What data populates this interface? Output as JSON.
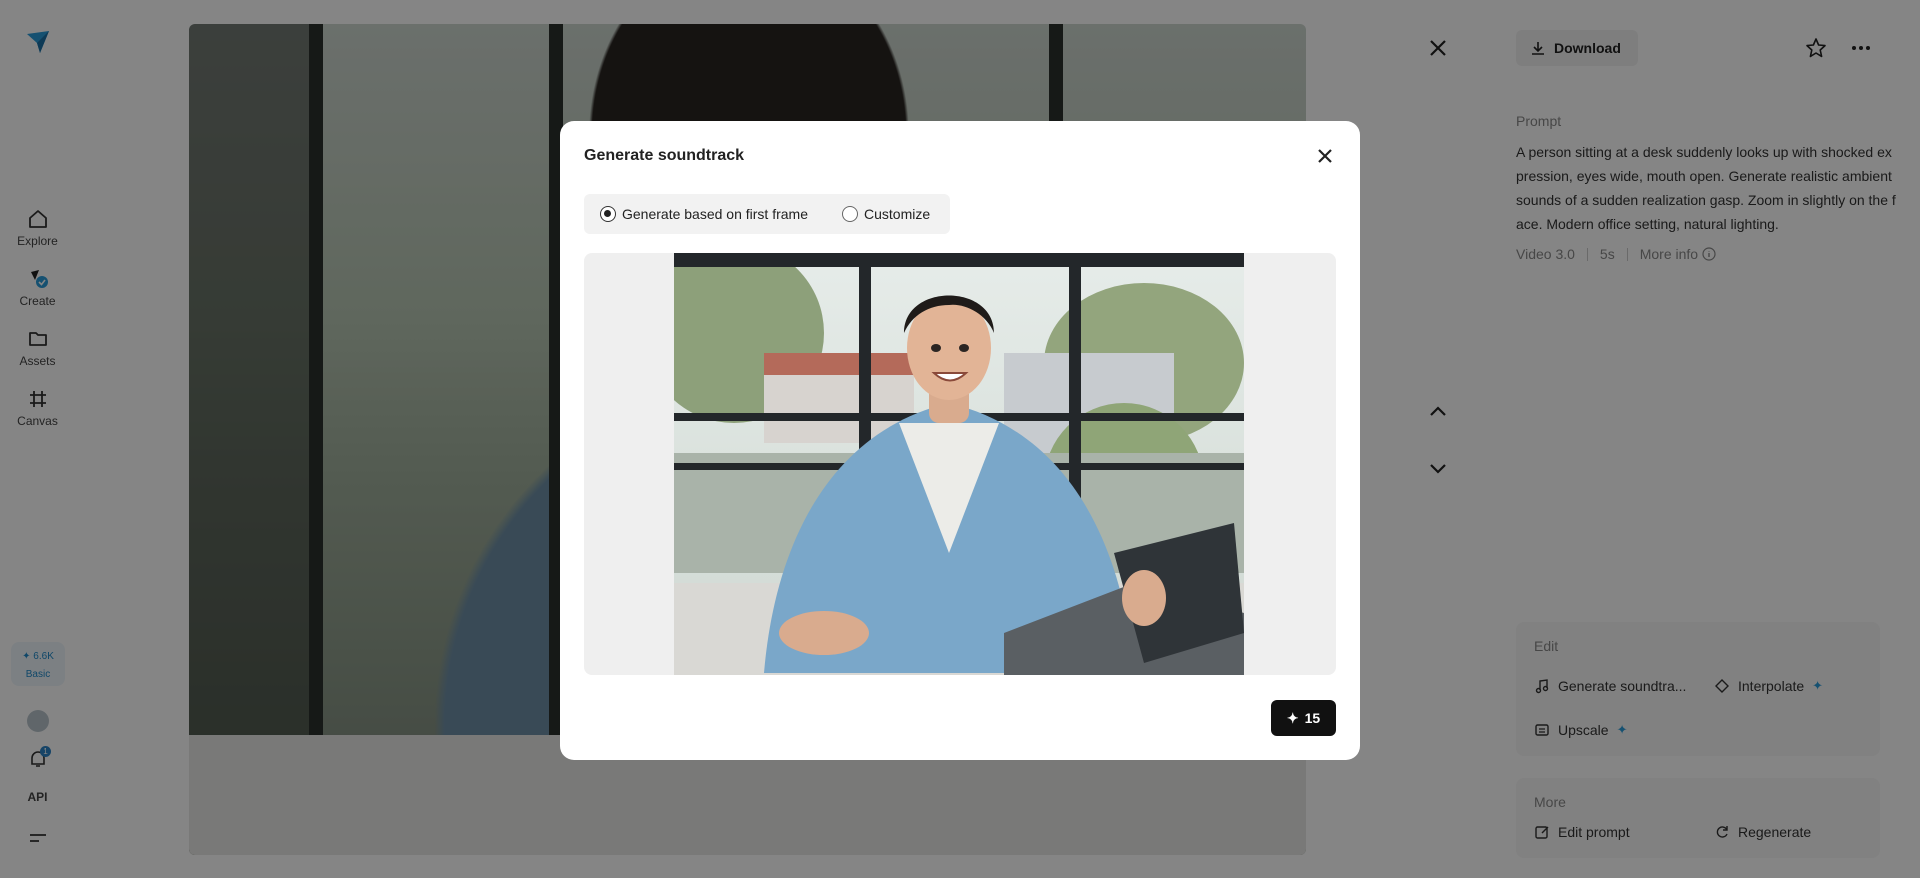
{
  "sidebar": {
    "items": [
      {
        "label": "Explore",
        "icon": "home-icon"
      },
      {
        "label": "Create",
        "icon": "create-icon"
      },
      {
        "label": "Assets",
        "icon": "folder-icon"
      },
      {
        "label": "Canvas",
        "icon": "canvas-icon"
      }
    ],
    "credits": {
      "amount": "6.6K",
      "plan": "Basic"
    },
    "notifications_count": "1",
    "api_label": "API"
  },
  "right_panel": {
    "download_label": "Download",
    "prompt_label": "Prompt",
    "prompt_text": "A person sitting at a desk suddenly looks up with shocked expression, eyes wide, mouth open. Generate realistic ambient sounds of a sudden realization gasp. Zoom in slightly on the face. Modern office setting, natural lighting.",
    "meta": {
      "model": "Video 3.0",
      "duration": "5s",
      "more_info": "More info"
    },
    "edit": {
      "title": "Edit",
      "actions": [
        {
          "label": "Generate soundtra...",
          "icon": "music-note-icon",
          "premium": false
        },
        {
          "label": "Interpolate",
          "icon": "interpolate-icon",
          "premium": true
        },
        {
          "label": "Upscale",
          "icon": "upscale-icon",
          "premium": true
        }
      ]
    },
    "more": {
      "title": "More",
      "actions": [
        {
          "label": "Edit prompt",
          "icon": "edit-icon"
        },
        {
          "label": "Regenerate",
          "icon": "regenerate-icon"
        }
      ]
    }
  },
  "modal": {
    "title": "Generate soundtrack",
    "options": [
      {
        "label": "Generate based on first frame",
        "selected": true
      },
      {
        "label": "Customize",
        "selected": false
      }
    ],
    "generate_cost": "15"
  },
  "colors": {
    "accent": "#2b9bd9",
    "overlay": "rgba(0,0,0,0.48)",
    "button_dark": "#111111"
  }
}
